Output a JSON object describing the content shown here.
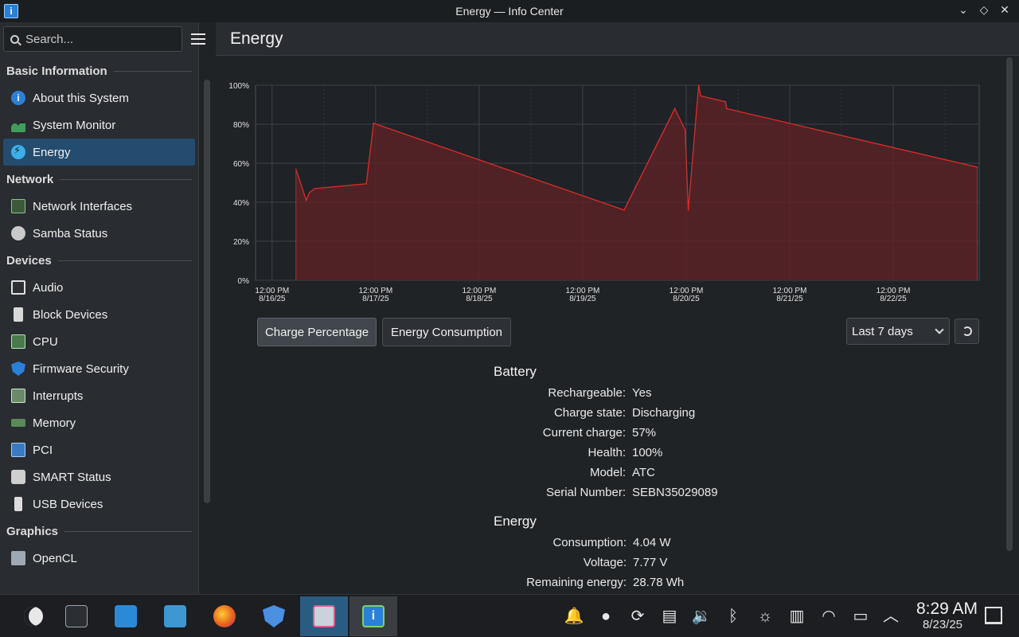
{
  "window": {
    "title": "Energy — Info Center"
  },
  "search": {
    "placeholder": "Search..."
  },
  "page": {
    "title": "Energy"
  },
  "sidebar": {
    "sections": [
      {
        "title": "Basic Information",
        "items": [
          {
            "label": "About this System",
            "icon": "info-icon"
          },
          {
            "label": "System Monitor",
            "icon": "system-monitor-icon"
          },
          {
            "label": "Energy",
            "icon": "energy-icon",
            "active": true
          }
        ]
      },
      {
        "title": "Network",
        "items": [
          {
            "label": "Network Interfaces",
            "icon": "network-card-icon"
          },
          {
            "label": "Samba Status",
            "icon": "share-icon"
          }
        ]
      },
      {
        "title": "Devices",
        "items": [
          {
            "label": "Audio",
            "icon": "audio-card-icon"
          },
          {
            "label": "Block Devices",
            "icon": "drive-icon"
          },
          {
            "label": "CPU",
            "icon": "cpu-icon"
          },
          {
            "label": "Firmware Security",
            "icon": "shield-icon"
          },
          {
            "label": "Interrupts",
            "icon": "interrupts-icon"
          },
          {
            "label": "Memory",
            "icon": "memory-icon"
          },
          {
            "label": "PCI",
            "icon": "pci-icon"
          },
          {
            "label": "SMART Status",
            "icon": "disk-health-icon"
          },
          {
            "label": "USB Devices",
            "icon": "usb-icon"
          }
        ]
      },
      {
        "title": "Graphics",
        "items": [
          {
            "label": "OpenCL",
            "icon": "opencl-icon"
          }
        ]
      }
    ]
  },
  "chart_data": {
    "type": "area",
    "title": "",
    "xlabel": "",
    "ylabel": "",
    "ylim": [
      0,
      100
    ],
    "y_ticks": [
      "0%",
      "20%",
      "40%",
      "60%",
      "80%",
      "100%"
    ],
    "x_ticks": [
      {
        "time": "12:00 PM",
        "date": "8/16/25"
      },
      {
        "time": "12:00 PM",
        "date": "8/17/25"
      },
      {
        "time": "12:00 PM",
        "date": "8/18/25"
      },
      {
        "time": "12:00 PM",
        "date": "8/19/25"
      },
      {
        "time": "12:00 PM",
        "date": "8/20/25"
      },
      {
        "time": "12:00 PM",
        "date": "8/21/25"
      },
      {
        "time": "12:00 PM",
        "date": "8/22/25"
      }
    ],
    "x_unit": "days since 8/16/25 12:00 PM",
    "xlim": [
      -0.16,
      6.83
    ],
    "series": [
      {
        "name": "",
        "color": "#da2c2c",
        "points": [
          [
            0.23,
            57
          ],
          [
            0.33,
            41
          ],
          [
            0.36,
            45
          ],
          [
            0.41,
            47
          ],
          [
            0.91,
            49.5
          ],
          [
            0.98,
            80.5
          ],
          [
            3.4,
            36
          ],
          [
            3.89,
            88
          ],
          [
            3.99,
            77
          ],
          [
            4.02,
            36
          ],
          [
            4.12,
            100
          ],
          [
            4.14,
            94.5
          ],
          [
            4.38,
            91.5
          ],
          [
            4.39,
            88
          ],
          [
            6.81,
            58
          ]
        ]
      }
    ],
    "grid": true,
    "line_color": "#da2c2c",
    "fill_color": "#5a2226"
  },
  "controls": {
    "charge_button": "Charge Percentage",
    "energy_button": "Energy Consumption",
    "range_value": "Last 7 days"
  },
  "battery": {
    "heading": "Battery",
    "rows": [
      {
        "k": "Rechargeable:",
        "v": "Yes"
      },
      {
        "k": "Charge state:",
        "v": "Discharging"
      },
      {
        "k": "Current charge:",
        "v": "57%"
      },
      {
        "k": "Health:",
        "v": "100%"
      },
      {
        "k": "Model:",
        "v": "ATC"
      },
      {
        "k": "Serial Number:",
        "v": "SEBN35029089"
      }
    ]
  },
  "energy": {
    "heading": "Energy",
    "rows": [
      {
        "k": "Consumption:",
        "v": "4.04 W"
      },
      {
        "k": "Voltage:",
        "v": "7.77 V"
      },
      {
        "k": "Remaining energy:",
        "v": "28.78 Wh"
      }
    ]
  },
  "taskbar": {
    "clock_time": "8:29 AM",
    "clock_date": "8/23/25"
  }
}
